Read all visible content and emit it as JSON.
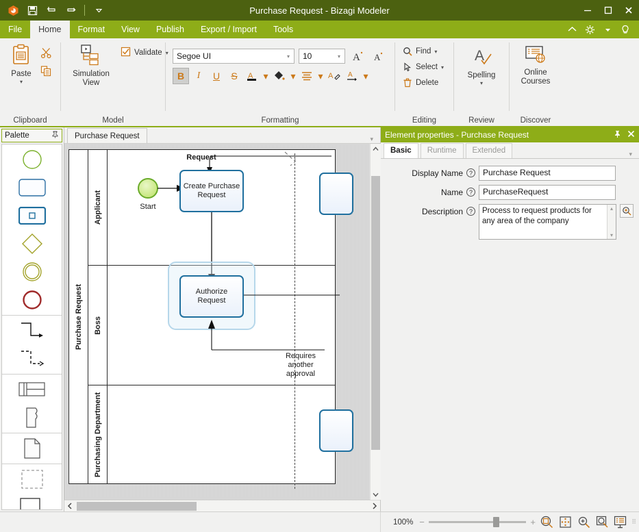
{
  "window": {
    "title": "Purchase Request - Bizagi Modeler",
    "app_icon": "bizagi-logo-icon",
    "quick_access": [
      {
        "name": "save-icon",
        "label": "Save"
      },
      {
        "name": "undo-icon",
        "label": "Undo"
      },
      {
        "name": "redo-icon",
        "label": "Redo"
      },
      {
        "name": "customize-quick-access-icon",
        "label": "Customize Quick Access Toolbar"
      }
    ],
    "controls": [
      {
        "name": "minimize-button",
        "glyph": "─"
      },
      {
        "name": "maximize-button",
        "glyph": "☐"
      },
      {
        "name": "close-button",
        "glyph": "✕"
      }
    ],
    "colors": {
      "titlebar": "#4c6110",
      "ribbon_green": "#8ead18",
      "ribbon_body": "#f1f1f0",
      "accent_orange": "#cc7a1a",
      "task_border": "#1f6f9e",
      "start_event": "#6aab2a"
    }
  },
  "ribbon": {
    "tabs": [
      {
        "label": "File",
        "active": false
      },
      {
        "label": "Home",
        "active": true
      },
      {
        "label": "Format",
        "active": false
      },
      {
        "label": "View",
        "active": false
      },
      {
        "label": "Publish",
        "active": false
      },
      {
        "label": "Export / Import",
        "active": false
      },
      {
        "label": "Tools",
        "active": false
      }
    ],
    "right_icons": [
      {
        "name": "collapse-ribbon-icon"
      },
      {
        "name": "gear-icon"
      },
      {
        "name": "gear-dropdown-icon"
      },
      {
        "name": "help-lightbulb-icon"
      }
    ],
    "groups": [
      {
        "label": "Clipboard",
        "big": {
          "label": "Paste",
          "icon": "paste-icon",
          "has_dropdown": true
        },
        "small": [
          {
            "label": "Cut",
            "icon": "scissors-icon"
          },
          {
            "label": "Copy",
            "icon": "copy-icon"
          }
        ]
      },
      {
        "label": "Model",
        "big": {
          "label": "Simulation View",
          "icon": "simulation-view-icon"
        },
        "small": [
          {
            "label": "Validate",
            "icon": "validate-checkbox-icon",
            "has_dropdown": true
          }
        ]
      },
      {
        "label": "Formatting",
        "font_name": "Segoe UI",
        "font_size": "10",
        "grow_font": "A",
        "shrink_font": "A",
        "buttons": [
          {
            "name": "bold-button",
            "glyph": "B",
            "active": true
          },
          {
            "name": "italic-button",
            "glyph": "I",
            "active": false
          },
          {
            "name": "underline-button",
            "glyph": "U",
            "active": false
          },
          {
            "name": "strikethrough-button",
            "glyph": "S",
            "active": false
          },
          {
            "name": "font-color-button",
            "glyph": "A",
            "active": false
          },
          {
            "name": "fill-color-button",
            "glyph": "◆",
            "active": false
          },
          {
            "name": "align-button",
            "glyph": "≡",
            "active": false
          },
          {
            "name": "format-painter-button",
            "glyph": "A",
            "active": false
          },
          {
            "name": "text-direction-button",
            "glyph": "A",
            "active": false
          }
        ]
      },
      {
        "label": "Editing",
        "small": [
          {
            "label": "Find",
            "icon": "search-icon",
            "has_dropdown": true
          },
          {
            "label": "Select",
            "icon": "cursor-select-icon",
            "has_dropdown": true
          },
          {
            "label": "Delete",
            "icon": "trash-icon",
            "has_dropdown": false
          }
        ]
      },
      {
        "label": "Review",
        "big": {
          "label": "Spelling",
          "icon": "spelling-check-icon",
          "has_dropdown": true
        }
      },
      {
        "label": "Discover",
        "big": {
          "label": "Online Courses",
          "icon": "online-courses-icon"
        }
      }
    ]
  },
  "palette": {
    "title": "Palette",
    "pin_icon": "pin-icon",
    "sections": [
      {
        "items": [
          {
            "name": "palette-start-event",
            "shape": "circle-green"
          },
          {
            "name": "palette-task",
            "shape": "rounded-rect-blue"
          },
          {
            "name": "palette-subprocess",
            "shape": "rounded-rect-subprocess"
          },
          {
            "name": "palette-gateway",
            "shape": "diamond-olive"
          },
          {
            "name": "palette-intermediate-event",
            "shape": "double-circle-olive"
          },
          {
            "name": "palette-end-event",
            "shape": "circle-red-thick"
          }
        ]
      },
      {
        "items": [
          {
            "name": "palette-sequence-flow",
            "shape": "solid-connector"
          },
          {
            "name": "palette-message-flow",
            "shape": "dashed-connector"
          }
        ]
      },
      {
        "items": [
          {
            "name": "palette-pool",
            "shape": "pool-table"
          },
          {
            "name": "palette-data-object",
            "shape": "data-object"
          }
        ]
      },
      {
        "items": [
          {
            "name": "palette-text-annotation-page",
            "shape": "page"
          }
        ]
      },
      {
        "items": [
          {
            "name": "palette-group",
            "shape": "dashed-square"
          },
          {
            "name": "palette-annotation",
            "shape": "annotation-link"
          }
        ]
      }
    ]
  },
  "document_tabs": [
    {
      "label": "Purchase Request",
      "active": true
    }
  ],
  "diagram": {
    "pool_name": "Purchase Request",
    "lanes": [
      {
        "name": "Applicant"
      },
      {
        "name": "Boss"
      },
      {
        "name": "Purchasing Department"
      }
    ],
    "elements": [
      {
        "type": "start-event",
        "label": "Start"
      },
      {
        "type": "task",
        "label": "Create Purchase Request",
        "selected": false
      },
      {
        "type": "task",
        "label": "Authorize Request",
        "selected": true
      }
    ],
    "flow_labels": [
      {
        "text": "Request"
      },
      {
        "text": "Requires another approval"
      }
    ]
  },
  "properties": {
    "header": "Element properties - Purchase Request",
    "pin_icon": "pin-icon",
    "close_icon": "close-icon",
    "tabs": [
      {
        "label": "Basic",
        "active": true
      },
      {
        "label": "Runtime",
        "active": false
      },
      {
        "label": "Extended",
        "active": false
      }
    ],
    "fields": [
      {
        "label": "Display Name",
        "value": "Purchase Request",
        "type": "text",
        "help": "?"
      },
      {
        "label": "Name",
        "value": "PurchaseRequest",
        "type": "text",
        "help": "?"
      },
      {
        "label": "Description",
        "value": "Process to request products for any area of the company",
        "type": "textarea",
        "help": "?"
      }
    ],
    "zoom_icon": "magnifier-plus-icon"
  },
  "statusbar": {
    "zoom_level": "100%",
    "zoom_out": "−",
    "zoom_in": "+",
    "buttons": [
      {
        "name": "zoom-to-selection-button"
      },
      {
        "name": "fit-to-page-button"
      },
      {
        "name": "zoom-in-button"
      },
      {
        "name": "zoom-region-button"
      },
      {
        "name": "full-screen-button"
      }
    ]
  }
}
